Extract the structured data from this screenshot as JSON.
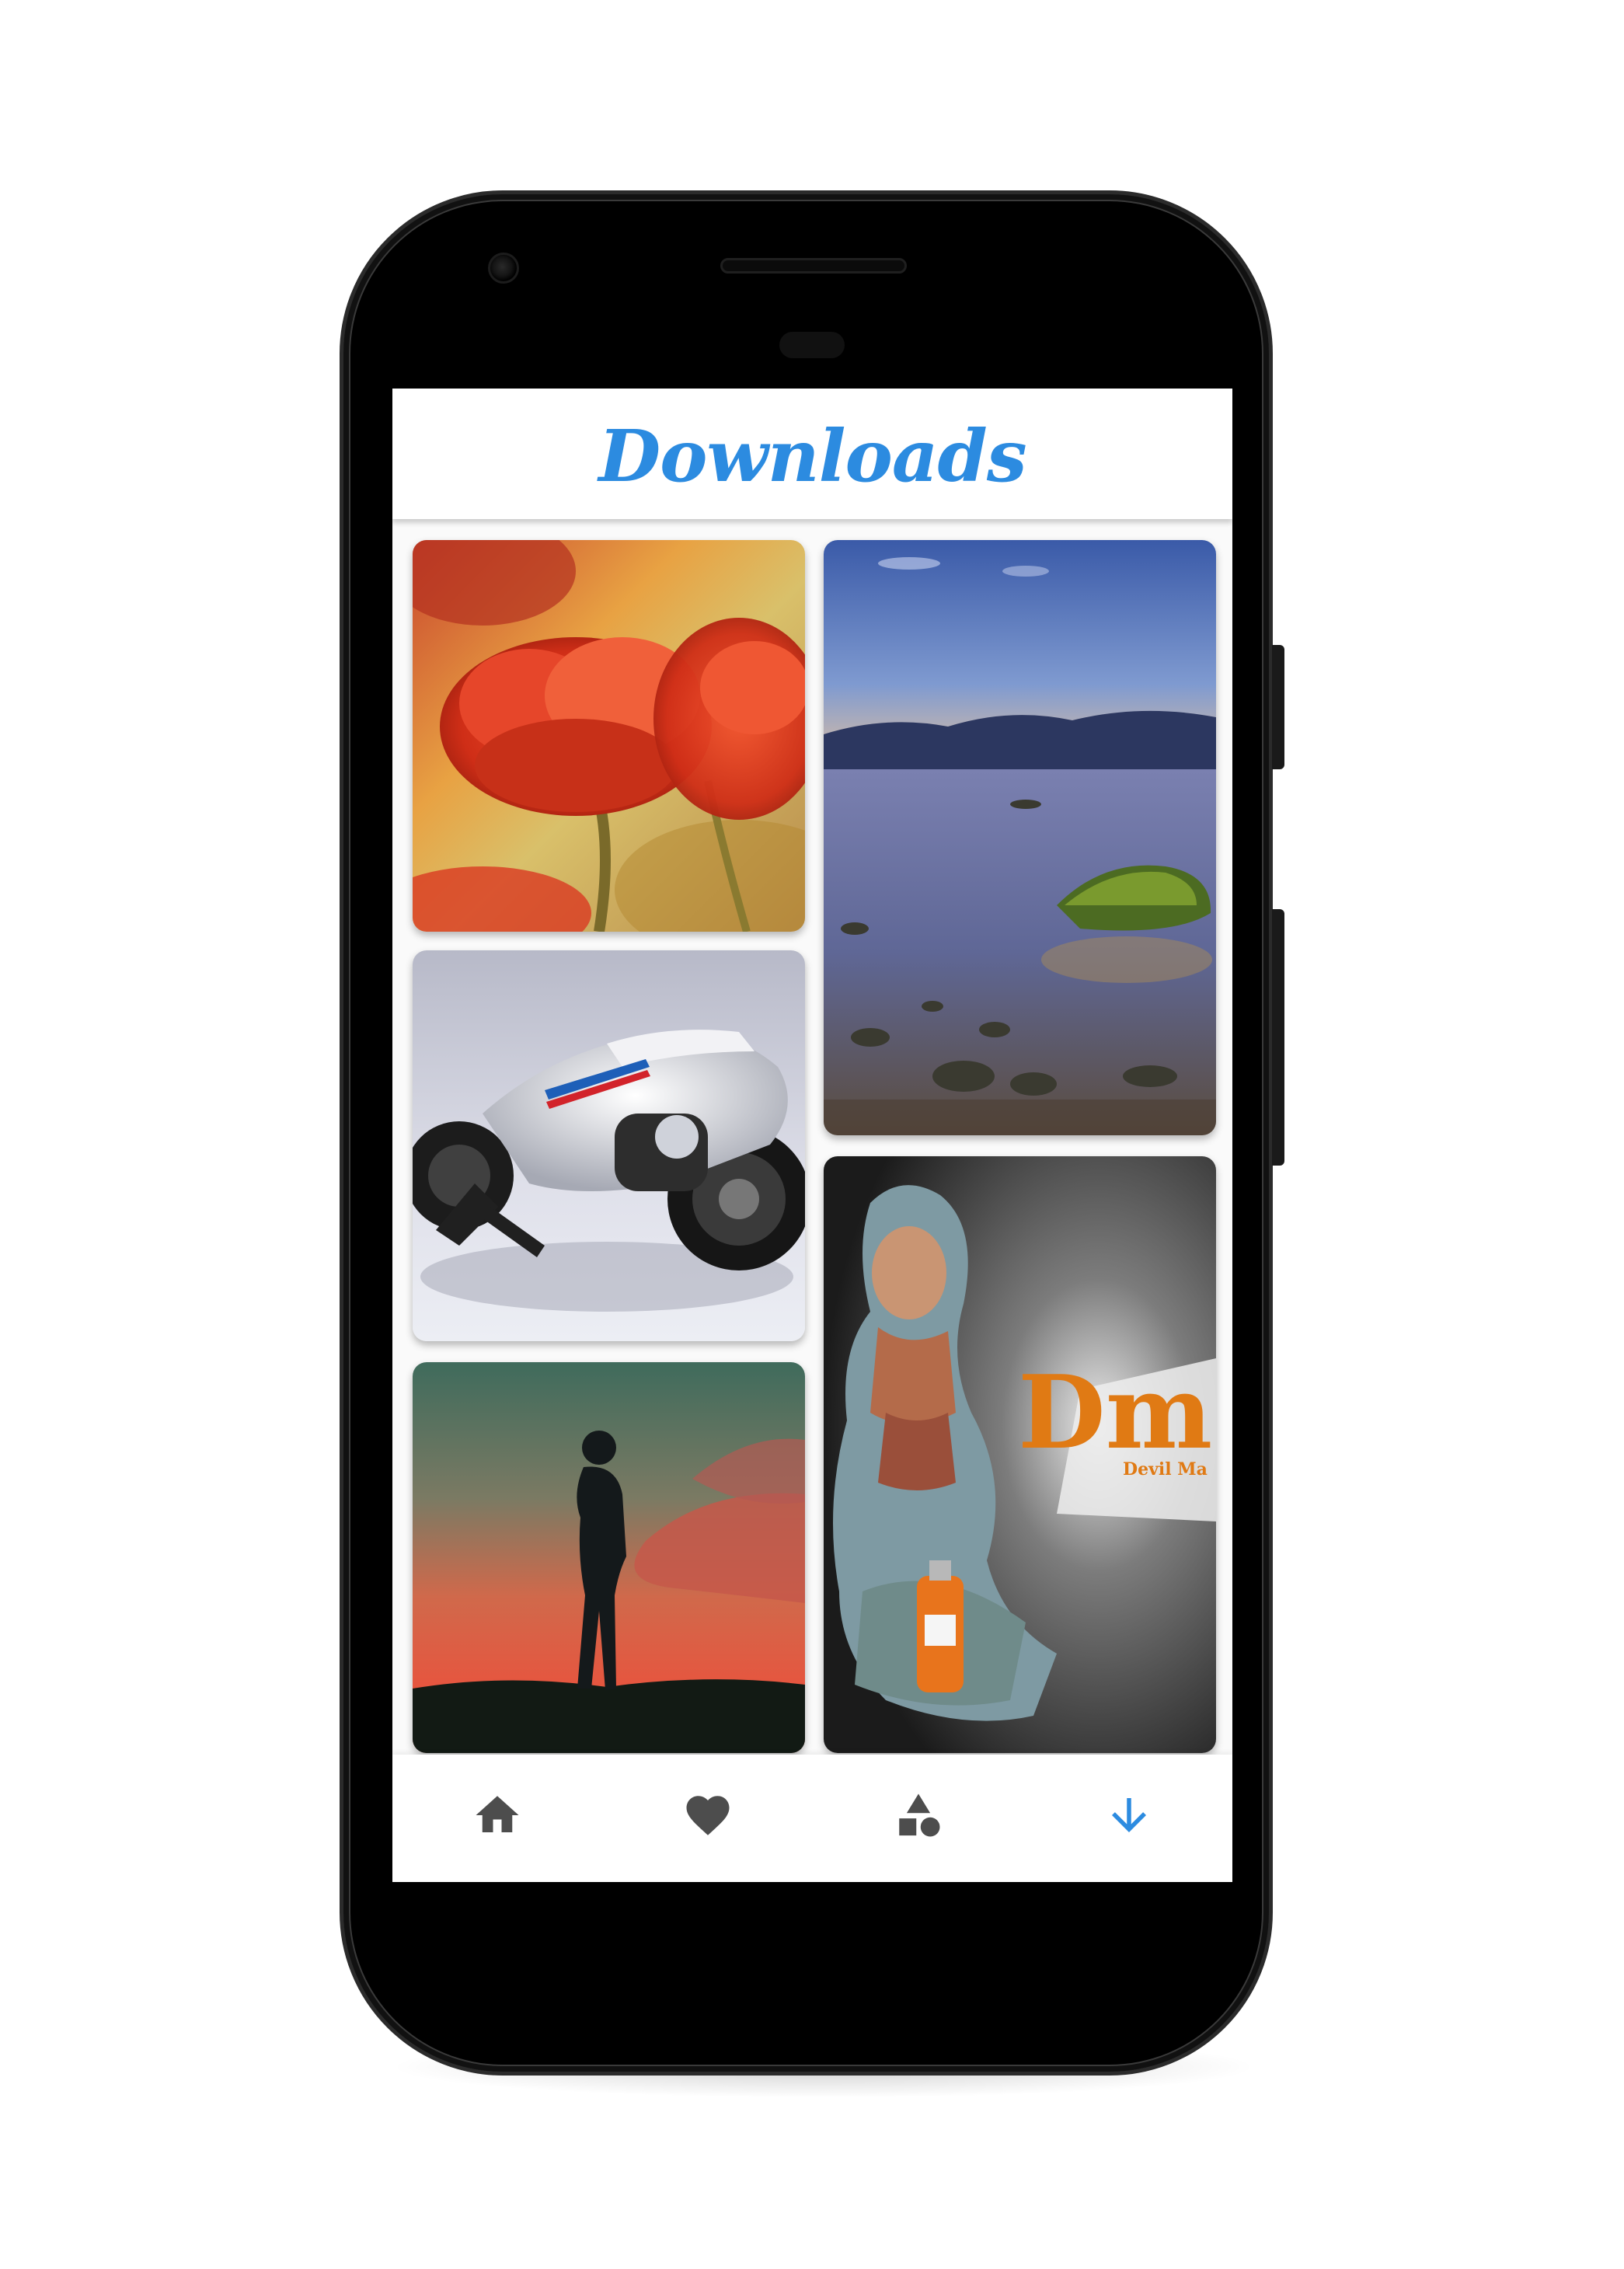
{
  "header": {
    "title": "Downloads"
  },
  "grid": {
    "items": [
      {
        "name": "red-flower-wallpaper"
      },
      {
        "name": "seascape-wallpaper"
      },
      {
        "name": "motorbike-wallpaper"
      },
      {
        "name": "silhouette-sunset-wallpaper"
      },
      {
        "name": "game-character-wallpaper",
        "text": "Dmc",
        "subtext": "Devil Ma"
      }
    ]
  },
  "bottom_nav": {
    "items": [
      {
        "icon": "home-icon",
        "active": false
      },
      {
        "icon": "heart-icon",
        "active": false
      },
      {
        "icon": "categories-shapes-icon",
        "active": false
      },
      {
        "icon": "download-arrow-icon",
        "active": true
      }
    ]
  },
  "colors": {
    "accent": "#2c8be0",
    "icon_inactive": "#4d4d4d",
    "phone_body": "#000000"
  }
}
